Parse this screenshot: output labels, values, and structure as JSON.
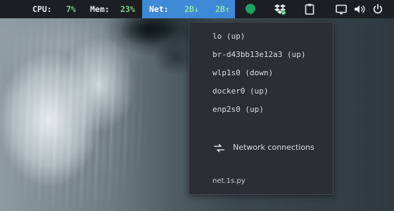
{
  "statusbar": {
    "cpu_label": "CPU:",
    "cpu_value": "7%",
    "mem_label": "Mem:",
    "mem_value": "23%",
    "net_label": "Net:",
    "net_down": "2B↓",
    "net_up": "2B↑"
  },
  "tray": {
    "icons": [
      "hangouts-icon",
      "dropbox-icon",
      "clipboard-icon",
      "display-icon",
      "volume-icon",
      "power-icon"
    ],
    "hangouts_color": "#1ea362",
    "accent_color": "#3f8ad6"
  },
  "network_menu": {
    "interfaces": [
      "lo (up)",
      "br-d43bb13e12a3 (up)",
      "wlp1s0 (down)",
      "docker0 (up)",
      "enp2s0 (up)"
    ],
    "connections_label": "Network connections",
    "footer": "net.1s.py"
  }
}
